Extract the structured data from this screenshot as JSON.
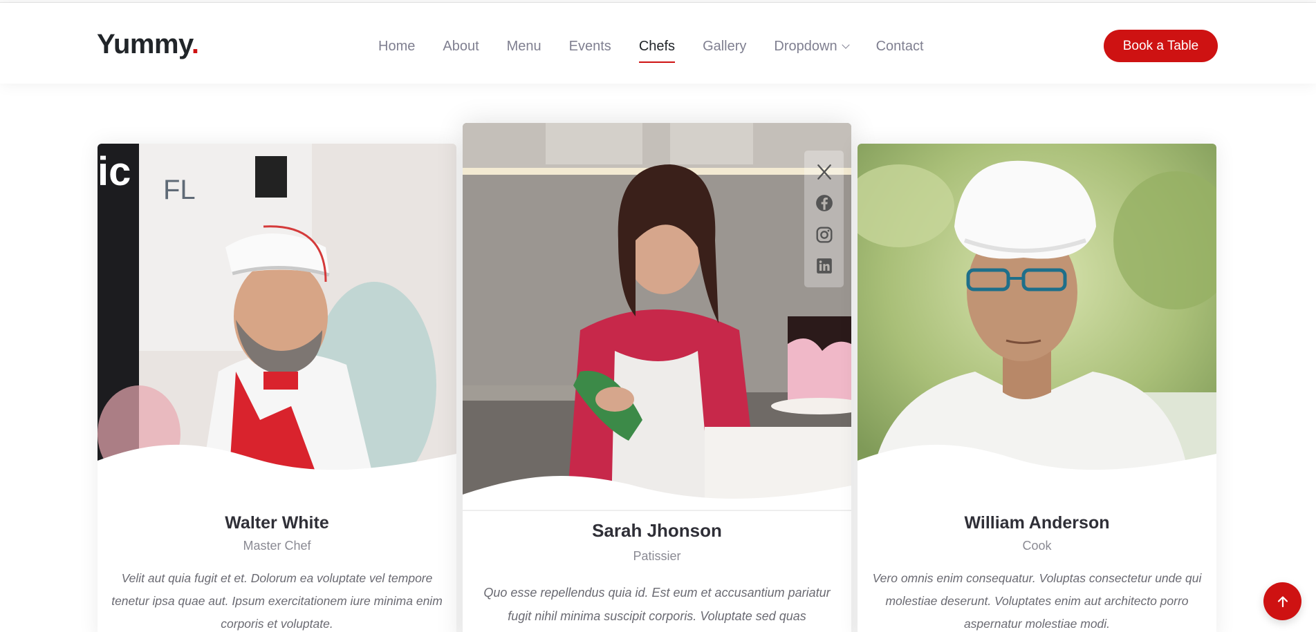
{
  "header": {
    "logo_text": "Yummy",
    "logo_dot": ".",
    "nav": [
      {
        "label": "Home"
      },
      {
        "label": "About"
      },
      {
        "label": "Menu"
      },
      {
        "label": "Events"
      },
      {
        "label": "Chefs",
        "active": true
      },
      {
        "label": "Gallery"
      },
      {
        "label": "Dropdown",
        "has_submenu": true
      },
      {
        "label": "Contact"
      }
    ],
    "cta_label": "Book a Table"
  },
  "chefs": [
    {
      "name": "Walter White",
      "role": "Master Chef",
      "description": "Velit aut quia fugit et et. Dolorum ea voluptate vel tempore tenetur ipsa quae aut. Ipsum exercitationem iure minima enim corporis et voluptate."
    },
    {
      "name": "Sarah Jhonson",
      "role": "Patissier",
      "description": "Quo esse repellendus quia id. Est eum et accusantium pariatur fugit nihil minima suscipit corporis. Voluptate sed quas",
      "social_icons": [
        "x-twitter-icon",
        "facebook-icon",
        "instagram-icon",
        "linkedin-icon"
      ]
    },
    {
      "name": "William Anderson",
      "role": "Cook",
      "description": "Vero omnis enim consequatur. Voluptas consectetur unde qui molestiae deserunt. Voluptates enim aut architecto porro aspernatur molestiae modi."
    }
  ],
  "colors": {
    "accent": "#ce1212",
    "heading": "#212529",
    "nav_text": "#7f7f90"
  },
  "scroll_top_icon": "arrow-up-icon"
}
